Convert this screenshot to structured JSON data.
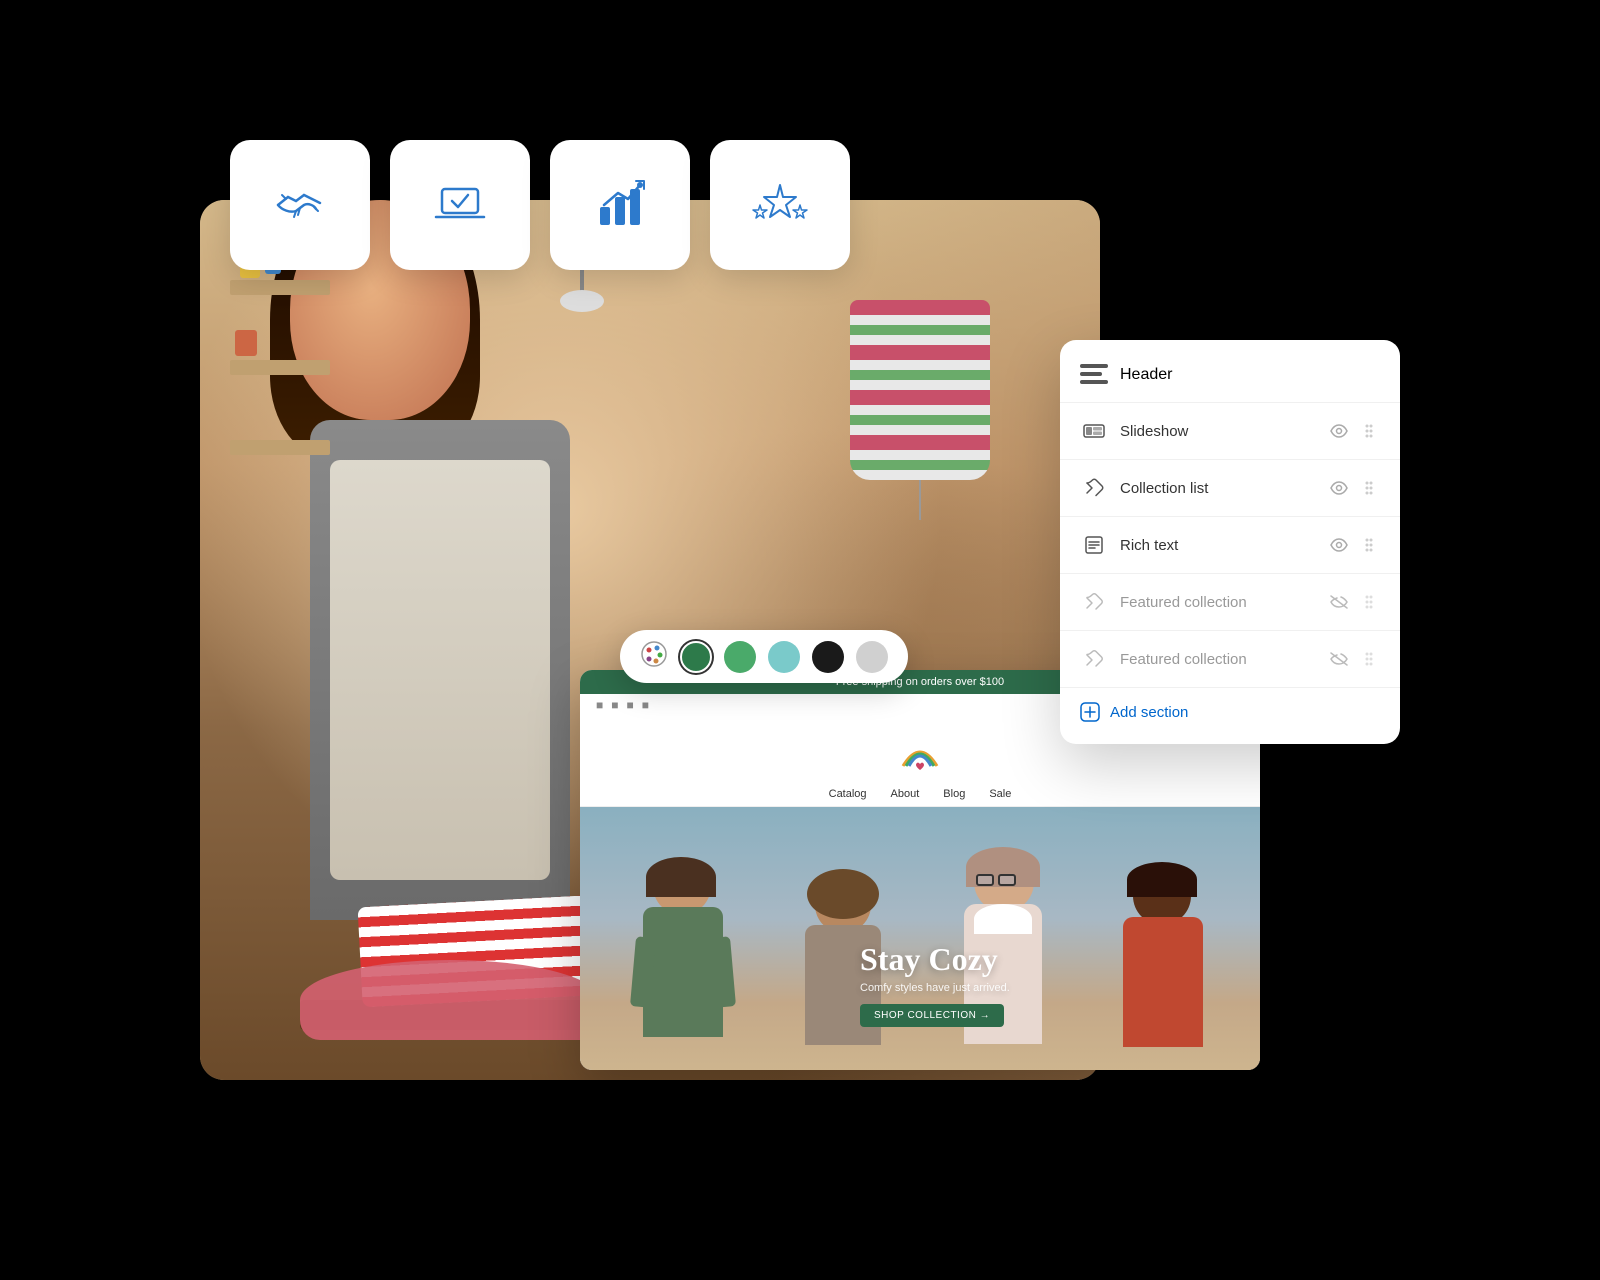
{
  "scene": {
    "icon_cards": [
      {
        "id": "handshake",
        "label": "Handshake icon"
      },
      {
        "id": "laptop-check",
        "label": "Laptop checkmark icon"
      },
      {
        "id": "chart",
        "label": "Bar chart icon"
      },
      {
        "id": "stars",
        "label": "Stars rating icon"
      }
    ],
    "panel": {
      "title": "Header",
      "items": [
        {
          "id": "slideshow",
          "label": "Slideshow",
          "icon": "slideshow-icon",
          "muted": false
        },
        {
          "id": "collection-list",
          "label": "Collection list",
          "icon": "tag-icon",
          "muted": false
        },
        {
          "id": "rich-text",
          "label": "Rich text",
          "icon": "text-icon",
          "muted": false
        },
        {
          "id": "featured-collection-1",
          "label": "Featured collection",
          "icon": "tag-icon",
          "muted": true
        },
        {
          "id": "featured-collection-2",
          "label": "Featured collection",
          "icon": "tag-icon",
          "muted": true
        }
      ],
      "add_section_label": "Add section"
    },
    "color_picker": {
      "colors": [
        "#2d7a4a",
        "#4aaa6a",
        "#7acaca",
        "#1a1a1a",
        "#d0d0d0"
      ]
    },
    "store_preview": {
      "announcement": "Free shipping on orders over $100",
      "nav_items": [
        "Catalog",
        "About",
        "Blog",
        "Sale"
      ],
      "hero": {
        "title": "Stay Cozy",
        "subtitle": "Comfy styles have just arrived.",
        "cta": "SHOP COLLECTION →"
      }
    }
  }
}
